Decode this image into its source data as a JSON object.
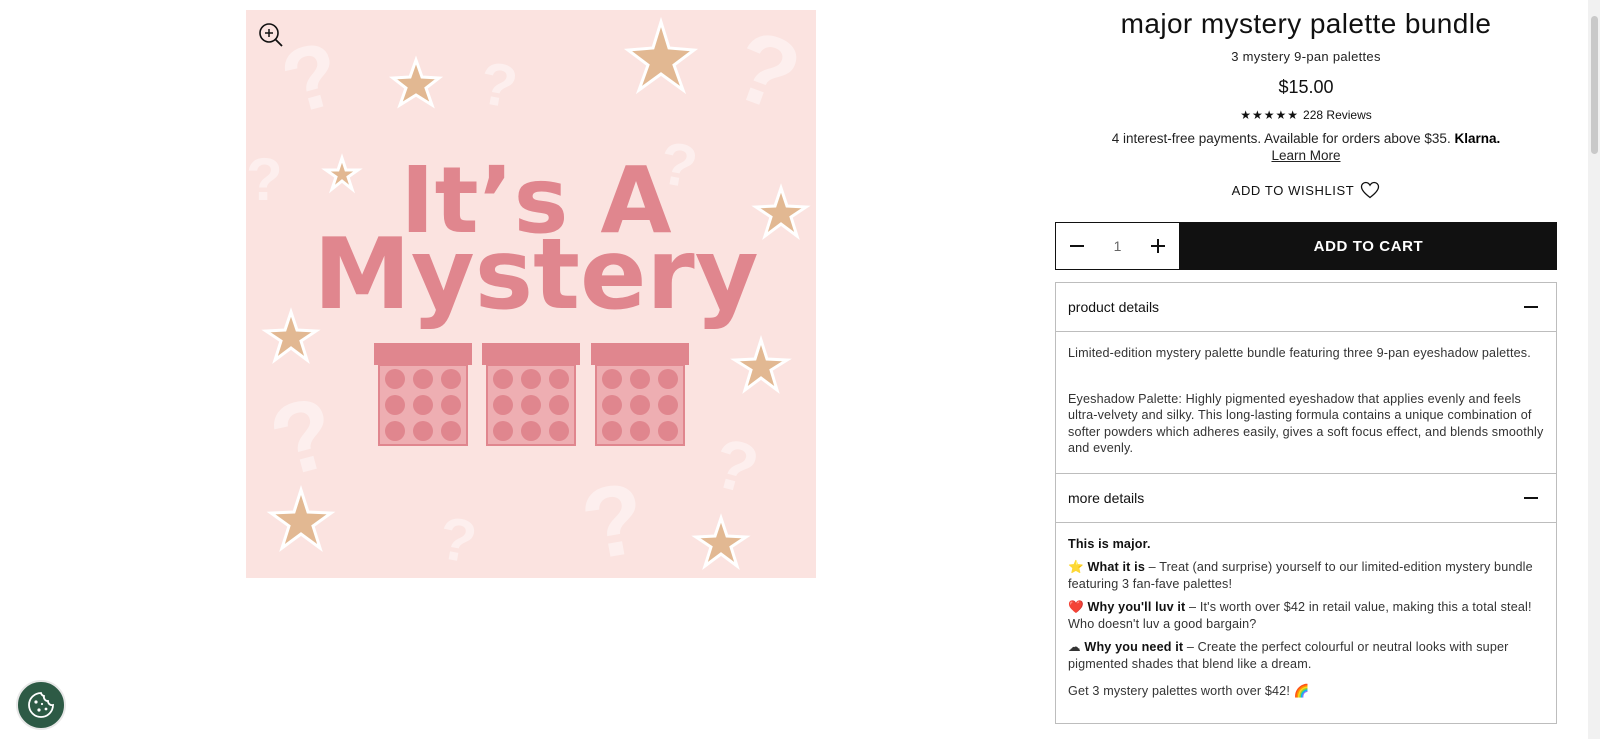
{
  "product": {
    "title": "major mystery palette bundle",
    "subtitle": "3 mystery 9-pan palettes",
    "price": "$15.00",
    "rating": {
      "stars": "★★★★★",
      "reviews_label": "228 Reviews"
    },
    "klarna": {
      "text": "4 interest-free payments. Available for orders above $35.",
      "brand": "Klarna.",
      "link": "Learn More"
    },
    "wishlist_label": "ADD TO WISHLIST",
    "quantity": "1",
    "add_to_cart_label": "ADD TO CART"
  },
  "image": {
    "line1": "It’s A",
    "line2": "Mystery"
  },
  "accordions": {
    "details": {
      "title": "product details",
      "para1": "Limited-edition mystery palette bundle featuring three 9-pan eyeshadow palettes.",
      "para2": "Eyeshadow Palette: Highly pigmented eyeshadow that applies evenly and feels ultra-velvety and silky. This long-lasting formula contains a unique combination of softer powders which adheres easily, gives a soft focus effect, and blends smoothly and evenly."
    },
    "more": {
      "title": "more details",
      "intro": "This is major.",
      "item1_label": "What it is",
      "item1_text": " – Treat (and surprise) yourself to our limited-edition mystery bundle featuring 3 fan-fave palettes!",
      "item2_label": "Why you'll luv it",
      "item2_text": " – It's worth over $42 in retail value, making this a total steal! Who doesn't luv a good bargain?",
      "item3_label": "Why you need it",
      "item3_text": " – Create the perfect colourful or neutral looks with super pigmented shades that blend like a dream.",
      "footer": "Get 3 mystery palettes worth over $42! 🌈"
    }
  },
  "colors": {
    "image_bg": "#fbe3e0",
    "title_pink": "#e0868e",
    "palette_pink": "#e8a2a8",
    "cart_bg": "#111111",
    "cookie_green": "#2d5a45"
  }
}
